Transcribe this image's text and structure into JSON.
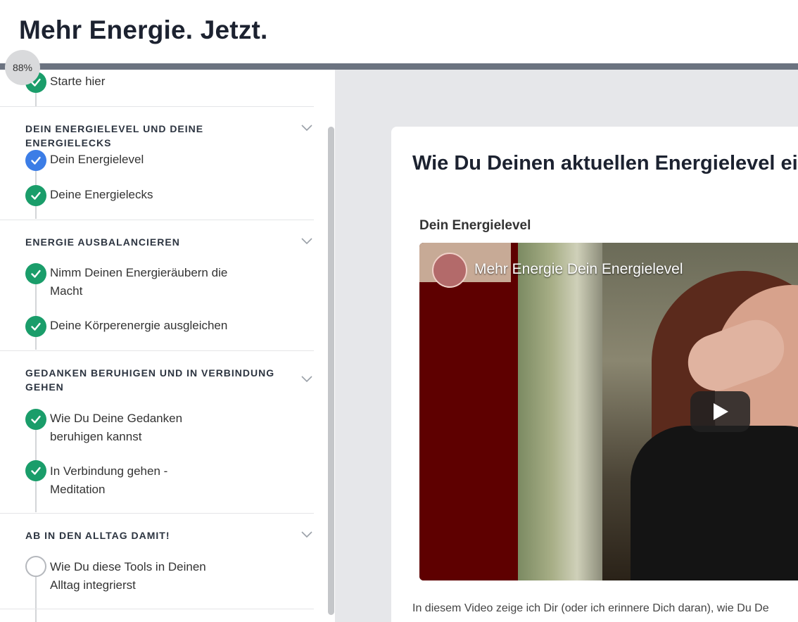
{
  "header": {
    "course_title": "Mehr Energie. Jetzt.",
    "progress_label": "88%",
    "progress": 0.88
  },
  "sidebar": {
    "lessons_top": [
      {
        "label_lines": [
          "Starte hier"
        ],
        "status": "done"
      }
    ],
    "sections": [
      {
        "title": "DEIN ENERGIELEVEL UND DEINE ENERGIELECKS",
        "lessons": [
          {
            "label_lines": [
              "Dein Energielevel"
            ],
            "status": "active"
          },
          {
            "label_lines": [
              "Deine Energielecks"
            ],
            "status": "done"
          }
        ]
      },
      {
        "title": "ENERGIE AUSBALANCIEREN",
        "lessons": [
          {
            "label_lines": [
              "Nimm Deinen Energieräubern die",
              "Macht"
            ],
            "status": "done"
          },
          {
            "label_lines": [
              "Deine Körperenergie ausgleichen"
            ],
            "status": "done"
          }
        ]
      },
      {
        "title_lines": [
          "GEDANKEN BERUHIGEN UND IN VERBINDUNG",
          "GEHEN"
        ],
        "lessons": [
          {
            "label_lines": [
              "Wie Du Deine Gedanken",
              "beruhigen kannst"
            ],
            "status": "done"
          },
          {
            "label_lines": [
              "In Verbindung gehen -",
              "Meditation"
            ],
            "status": "done"
          }
        ]
      },
      {
        "title": "AB IN DEN ALLTAG DAMIT!",
        "lessons": [
          {
            "label_lines": [
              "Wie Du diese Tools in Deinen",
              "Alltag integrierst"
            ],
            "status": "open"
          }
        ]
      }
    ]
  },
  "main": {
    "lesson_title": "Wie Du Deinen aktuellen Energielevel ein",
    "video_heading": "Dein Energielevel",
    "video_title": "Mehr Energie Dein Energielevel",
    "description": "In diesem Video zeige ich Dir (oder ich erinnere Dich daran), wie Du De"
  },
  "colors": {
    "done": "#1a9d6a",
    "active": "#3c7de6",
    "progress_bar": "#6b7380",
    "main_bg": "#e6e7ea"
  }
}
